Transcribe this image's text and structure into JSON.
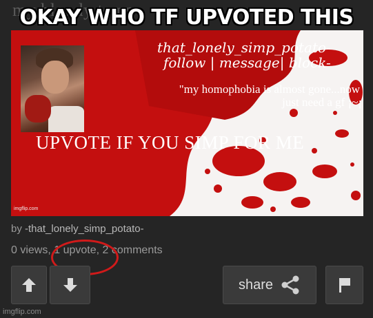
{
  "ghost_title": "my bloody temp",
  "caption": "OKAY WHO TF UPVOTED THIS",
  "post_image": {
    "username_lines": [
      "that_lonely_simp_potato-",
      "follow | message| block-"
    ],
    "quote": "\"my homophobia is almost gone...now I just need a gf ¡~¡\"",
    "banner": "UPVOTE IF YOU SIMP FOR ME",
    "small_watermark": "imgflip.com"
  },
  "meta": {
    "by_prefix": "by",
    "author": "-that_lonely_simp_potato-",
    "stats": "0 views, 1 upvote, 2 comments"
  },
  "actions": {
    "share_label": "share"
  },
  "watermark": "imgflip.com",
  "colors": {
    "background": "#252525",
    "blood_red": "#c40f0f",
    "annotation_circle": "#d11a1a"
  },
  "icons": [
    "upvote-arrow-icon",
    "downvote-arrow-icon",
    "share-icon",
    "flag-icon"
  ]
}
